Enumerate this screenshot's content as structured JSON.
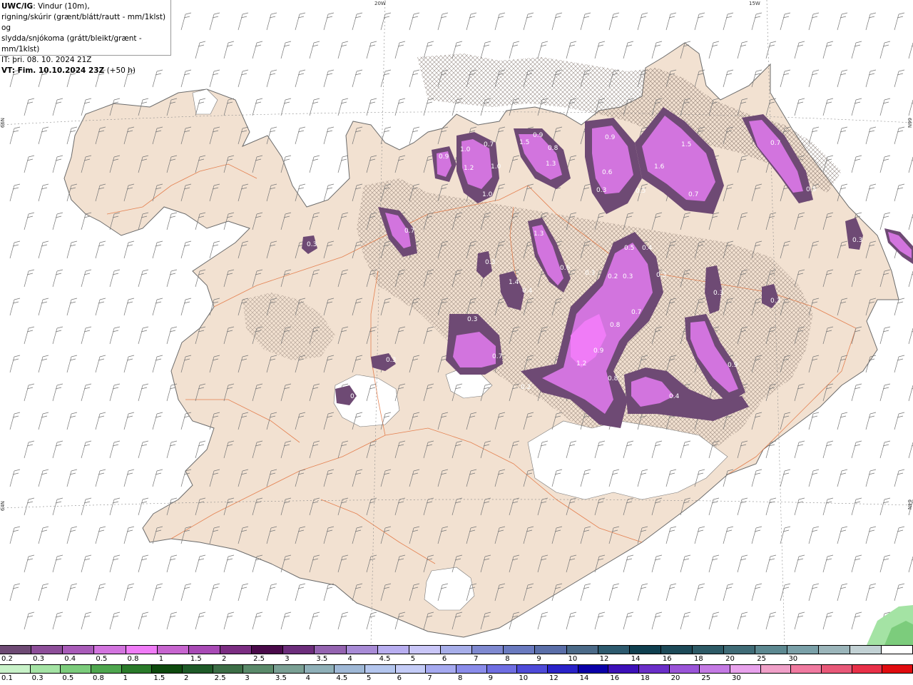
{
  "info": {
    "title": "UWC/IG",
    "title_rest": ": Vindur (10m),",
    "line2": "rigning/skúrir (grænt/blátt/rautt - mm/1klst) og",
    "line3": "slydda/snjókoma (grátt/bleikt/grænt - mm/1klst)",
    "it": "IT: þri. 08. 10. 2024 21Z",
    "vt_label": "VT: Fim. 10.10.2024 23Z",
    "vt_rest": " (+50 h)"
  },
  "coords": {
    "top_20w": "20W",
    "top_15w": "15W",
    "left_66n": "66N",
    "right_66n": "66N",
    "left_64n": "64N",
    "right_64n": "64N"
  },
  "map_labels": [
    "0.9",
    "1.0",
    "1.2",
    "0.7",
    "1.0",
    "1.5",
    "0.9",
    "0.8",
    "1.3",
    "1.6",
    "0.6",
    "1.0",
    "1.5",
    "0.9",
    "0.3",
    "0.5",
    "0.7",
    "0.3",
    "1.4",
    "0.4",
    "1.3",
    "0.6",
    "0.5",
    "0.4",
    "0.2",
    "0.3",
    "0.3",
    "0.3",
    "0.7",
    "0.8",
    "0.9",
    "1.2",
    "0.8",
    "0.4",
    "0.3",
    "0.9",
    "0.3",
    "0.7",
    "0.2",
    "0.5",
    "0.3",
    "0.3",
    "0.3",
    "0.7",
    "0.7",
    "0.5",
    "0.3"
  ],
  "legend_snow": {
    "colors": [
      "#6e4a74",
      "#8d4e99",
      "#a85bb8",
      "#d274de",
      "#f07cf7",
      "#c765cf",
      "#a84ab5",
      "#7b2d82",
      "#4a0a4a",
      "#6c2d7b",
      "#9463b0",
      "#a88bd6",
      "#b8aef0",
      "#c9c6f7",
      "#a7aee9",
      "#7f89d0",
      "#6a7abf",
      "#5a6ea8",
      "#4b6a88",
      "#2d5a6e",
      "#0f3f4f",
      "#1d4a58",
      "#2d5a66",
      "#3f6b76",
      "#5c8890",
      "#7aa0a8",
      "#9bb5ba",
      "#c2d1d4",
      "#ffffff"
    ],
    "ticks": [
      "0.2",
      "0.3",
      "0.4",
      "0.5",
      "0.8",
      "1",
      "1.5",
      "2",
      "2.5",
      "3",
      "3.5",
      "4",
      "4.5",
      "5",
      "6",
      "7",
      "8",
      "9",
      "10",
      "12",
      "14",
      "16",
      "18",
      "20",
      "25",
      "30"
    ]
  },
  "legend_rain": {
    "colors": [
      "#c8f2c8",
      "#a4e3a4",
      "#7ccc7c",
      "#4ea64e",
      "#2a7a2a",
      "#0e4a0e",
      "#1e5a28",
      "#3c6e46",
      "#5a8a6a",
      "#7aa094",
      "#8fb0b8",
      "#9fb8d6",
      "#b4c6ee",
      "#c4ccf7",
      "#a6aaf0",
      "#8a8cea",
      "#6f6ee2",
      "#4e4ad8",
      "#2a22c8",
      "#0a00a8",
      "#3c10b8",
      "#6a2ec8",
      "#9a54d8",
      "#c47ae4",
      "#e8a2ec",
      "#f0a0c8",
      "#f07aa0",
      "#e85878",
      "#e83048",
      "#e00c10"
    ],
    "ticks": [
      "0.1",
      "0.3",
      "0.5",
      "0.8",
      "1",
      "1.5",
      "2",
      "2.5",
      "3",
      "3.5",
      "4",
      "4.5",
      "5",
      "6",
      "7",
      "8",
      "9",
      "10",
      "12",
      "14",
      "16",
      "18",
      "20",
      "25",
      "30"
    ]
  }
}
